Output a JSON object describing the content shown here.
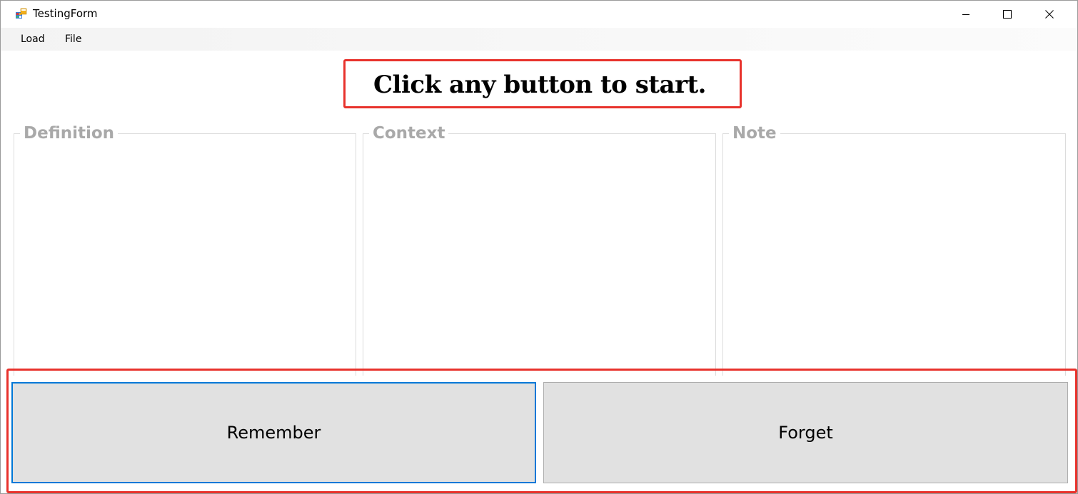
{
  "window": {
    "title": "TestingForm",
    "icon": "winforms-app-icon",
    "controls": {
      "minimize_icon": "minimize-icon",
      "maximize_icon": "maximize-icon",
      "close_icon": "close-icon"
    }
  },
  "menu": {
    "items": [
      {
        "label": "Load"
      },
      {
        "label": "File"
      }
    ]
  },
  "instruction": {
    "text": "Click any button to start."
  },
  "groups": [
    {
      "title": "Definition",
      "content": ""
    },
    {
      "title": "Context",
      "content": ""
    },
    {
      "title": "Note",
      "content": ""
    }
  ],
  "actions": {
    "remember_label": "Remember",
    "forget_label": "Forget"
  },
  "colors": {
    "highlight_border": "#e8322c",
    "focus_border": "#0078d7",
    "button_face": "#e1e1e1",
    "group_title": "#a9a9a9"
  }
}
